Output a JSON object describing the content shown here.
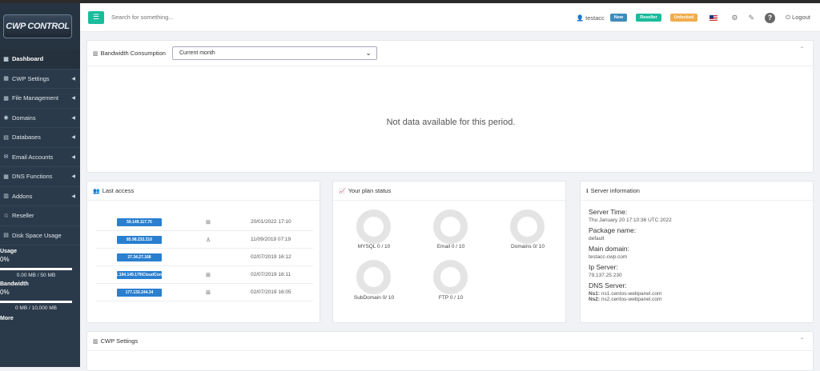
{
  "brand": {
    "logo_text": "CWP CONTROL"
  },
  "header": {
    "search_placeholder": "Search for something...",
    "user": "testacc",
    "badges": [
      "New",
      "Reseller",
      "Unlocked"
    ],
    "logout": "Logout"
  },
  "sidebar": {
    "items": [
      {
        "icon": "▦",
        "label": "Dashboard",
        "active": true,
        "caret": false
      },
      {
        "icon": "▦",
        "label": "CWP Settings",
        "caret": true
      },
      {
        "icon": "▦",
        "label": "File Management",
        "caret": true
      },
      {
        "icon": "◉",
        "label": "Domains",
        "caret": true
      },
      {
        "icon": "▤",
        "label": "Databases",
        "caret": true
      },
      {
        "icon": "✉",
        "label": "Email Accounts",
        "caret": true
      },
      {
        "icon": "▦",
        "label": "DNS Functions",
        "caret": true
      },
      {
        "icon": "▥",
        "label": "Addons",
        "caret": true
      },
      {
        "icon": "♲",
        "label": "Reseller",
        "caret": false
      },
      {
        "icon": "▤",
        "label": "Disk Space Usage",
        "caret": false
      }
    ],
    "disk": {
      "title": "Usage",
      "pct": "0%",
      "value": "0.00 MB / 50 MB"
    },
    "bandwidth": {
      "title": "Bandwidth",
      "pct": "0%",
      "value": "0 MB / 10,000 MB"
    },
    "more": "More"
  },
  "bandwidth": {
    "title": "Bandwidth Consumption",
    "select": "Current month",
    "message": "Not data available for this period."
  },
  "last_access": {
    "title": "Last access",
    "rows": [
      {
        "ip": "59.149.117.70",
        "os": "windows",
        "date": "20/01/2022 17:10"
      },
      {
        "ip": "85.98.232.210",
        "os": "linux",
        "date": "11/09/2019 07:19"
      },
      {
        "ip": "27.34.27.168",
        "os": "apple",
        "date": "02/07/2019 16:12"
      },
      {
        "ip": "1.194.149.179\\CloudCont",
        "os": "windows",
        "date": "02/07/2019 16:11"
      },
      {
        "ip": "177.133.244.34",
        "os": "windows",
        "date": "02/07/2019 16:05"
      }
    ]
  },
  "plan": {
    "title": "Your plan status",
    "items": [
      {
        "label": "MYSQL 0 / 10",
        "used": 0
      },
      {
        "label": "Email 0 / 10",
        "used": 0
      },
      {
        "label": "Domains 0/ 10",
        "used": 0
      },
      {
        "label": "SubDomain 0/ 10",
        "used": 0
      },
      {
        "label": "FTP 0 / 10",
        "used": 0
      }
    ]
  },
  "server": {
    "title": "Server information",
    "time_label": "Server Time:",
    "time": "Thu January 20 17:10:36 UTC 2022",
    "pkg_label": "Package name:",
    "pkg": "default",
    "domain_label": "Main domain:",
    "domain": "testacc-cwp.com",
    "ip_label": "Ip Server:",
    "ip": "79.137.25.230",
    "dns_label": "DNS Server:",
    "ns1_label": "Ns1:",
    "ns1": "ns1.centos-webpanel.com",
    "ns2_label": "Ns2:",
    "ns2": "ns2.centos-webpanel.com"
  },
  "cwp_settings": {
    "title": "CWP Settings"
  },
  "colors": {
    "accent": "#1abc9c",
    "sidebar": "#2b3a4a",
    "ip_badge": "#2a7fcf"
  }
}
